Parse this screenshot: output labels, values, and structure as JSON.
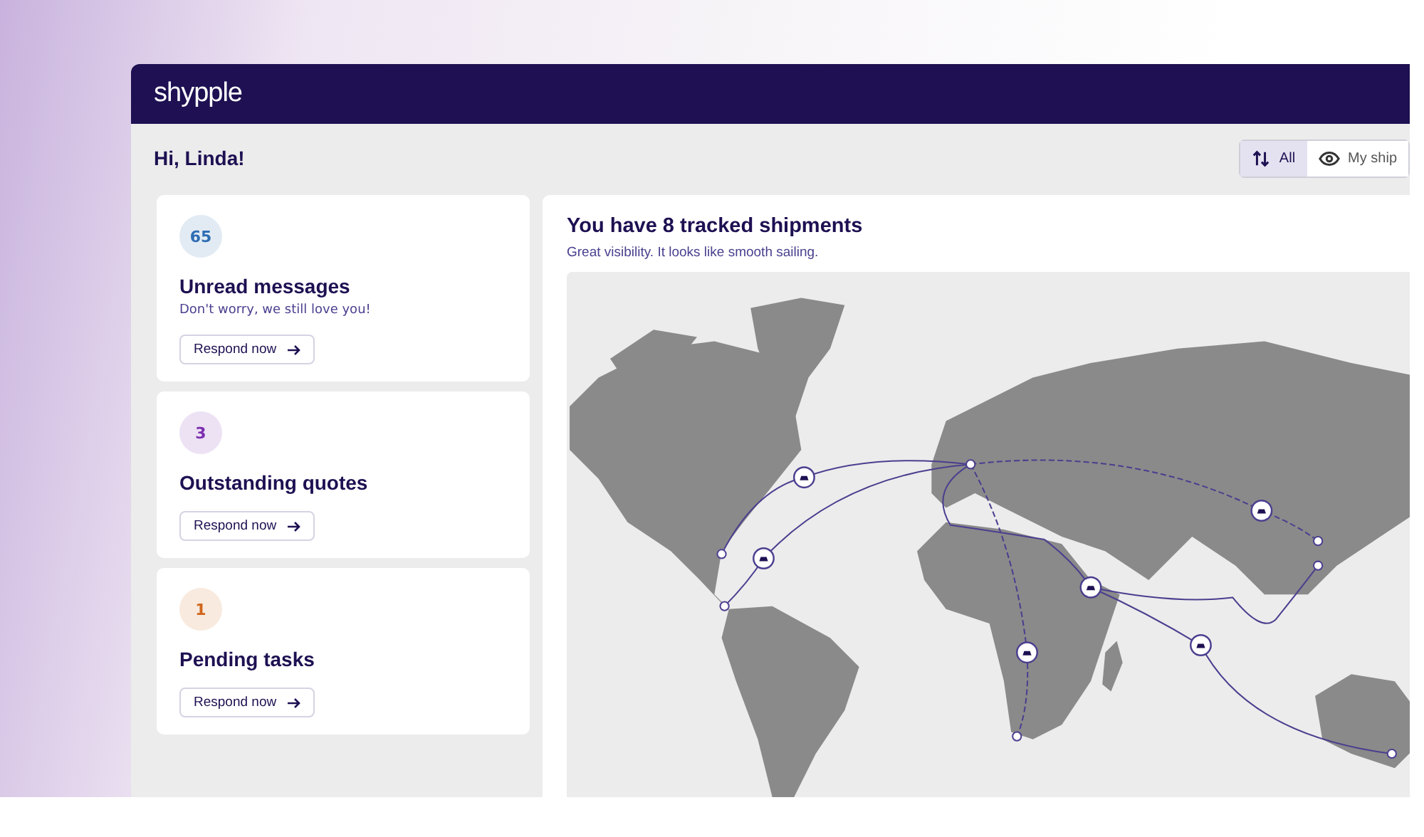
{
  "header": {
    "logo": "shypple"
  },
  "greeting": "Hi, Linda!",
  "view_toggle": [
    {
      "label": "All",
      "kind": "all",
      "selected": true
    },
    {
      "label": "My ship",
      "kind": "mine",
      "selected": false
    }
  ],
  "cards": [
    {
      "count": "65",
      "color": "#2f6db3",
      "title": "Unread messages",
      "subtitle": "Don't worry, we still love you!",
      "button": "Respond now"
    },
    {
      "count": "3",
      "color": "#7b2fb0",
      "title": "Outstanding quotes",
      "button": "Respond now"
    },
    {
      "count": "1",
      "color": "#d0661c",
      "title": "Pending tasks",
      "button": "Respond now"
    }
  ],
  "shipments": {
    "title": "You have 8 tracked shipments",
    "subtitle": "Great visibility. It looks like smooth sailing."
  }
}
